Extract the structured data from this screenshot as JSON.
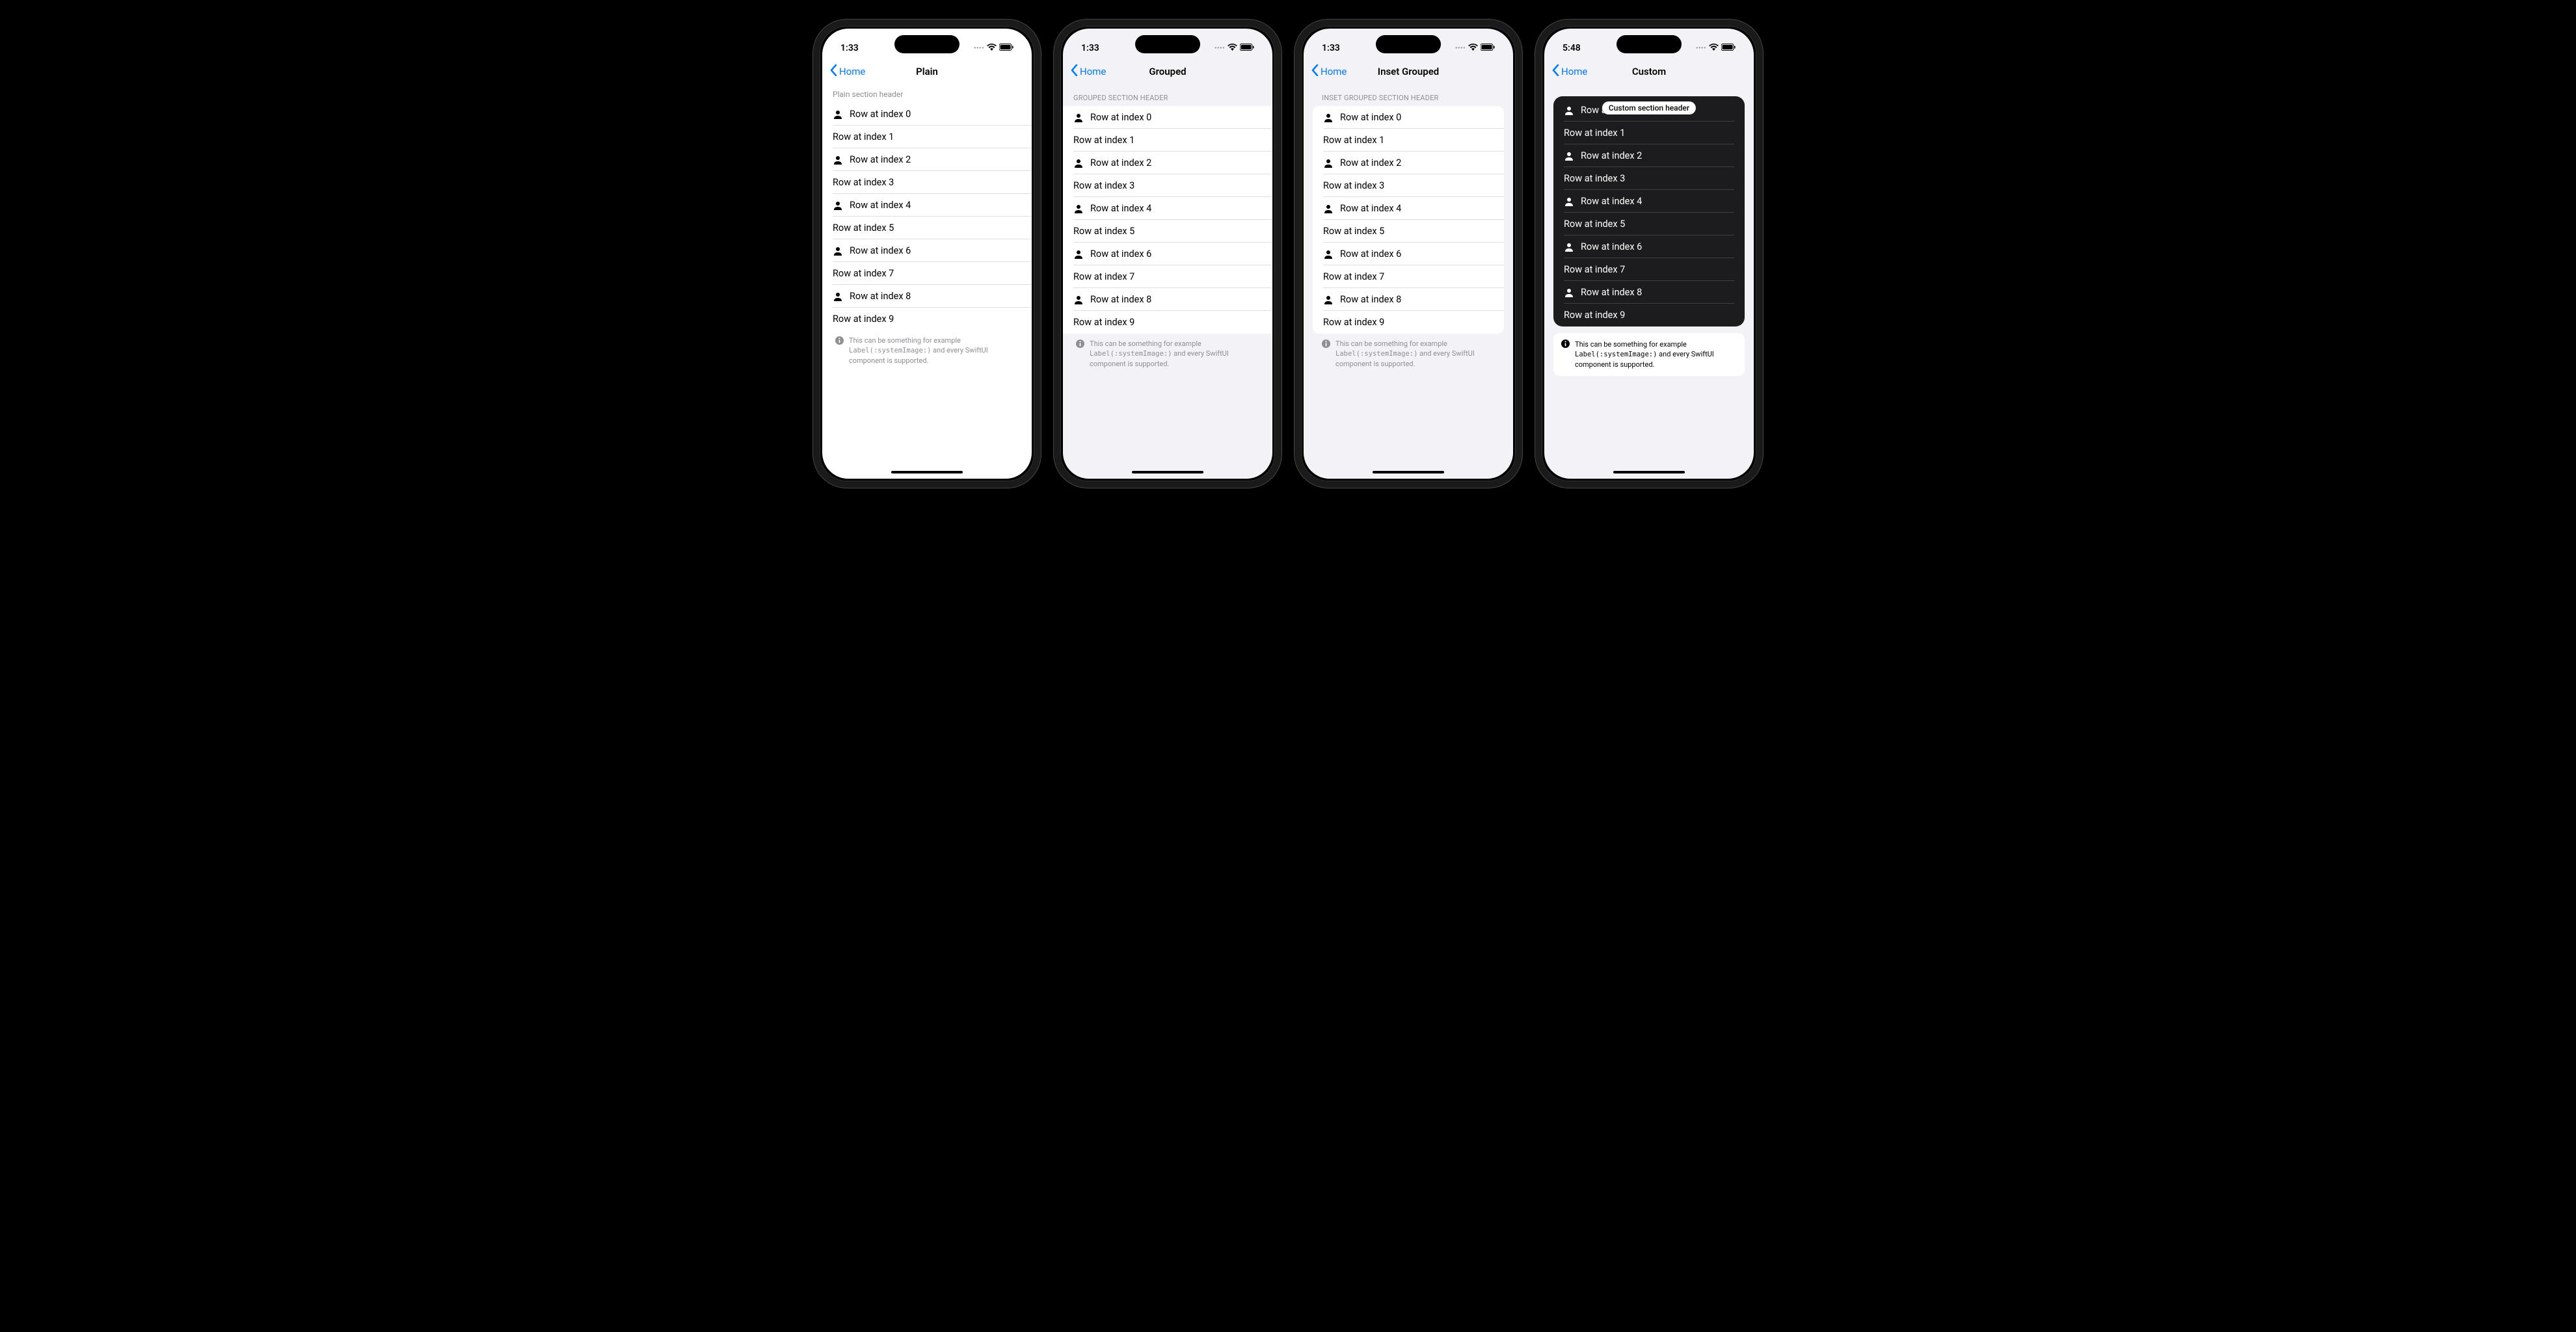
{
  "status": {
    "time_a": "1:33",
    "time_b": "5:48"
  },
  "nav": {
    "back": "Home",
    "titles": {
      "plain": "Plain",
      "grouped": "Grouped",
      "inset": "Inset Grouped",
      "custom": "Custom"
    }
  },
  "headers": {
    "plain": "Plain section header",
    "grouped": "GROUPED SECTION HEADER",
    "inset": "INSET GROUPED SECTION HEADER",
    "custom": "Custom section header"
  },
  "rows": [
    "Row at index 0",
    "Row at index 1",
    "Row at index 2",
    "Row at index 3",
    "Row at index 4",
    "Row at index 5",
    "Row at index 6",
    "Row at index 7",
    "Row at index 8",
    "Row at index 9"
  ],
  "footer": {
    "pre": "This can be something for example",
    "code": "Label(:systemImage:)",
    "post": "and every SwiftUI component is supported."
  }
}
